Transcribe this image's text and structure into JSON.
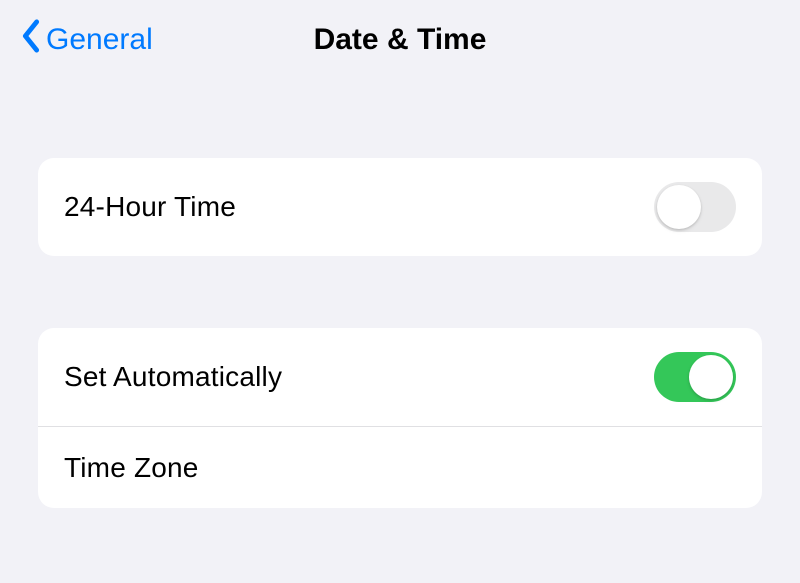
{
  "header": {
    "back_label": "General",
    "title": "Date & Time"
  },
  "groups": [
    {
      "rows": [
        {
          "label": "24-Hour Time",
          "toggle": false
        }
      ]
    },
    {
      "rows": [
        {
          "label": "Set Automatically",
          "toggle": true
        },
        {
          "label": "Time Zone"
        }
      ]
    }
  ]
}
